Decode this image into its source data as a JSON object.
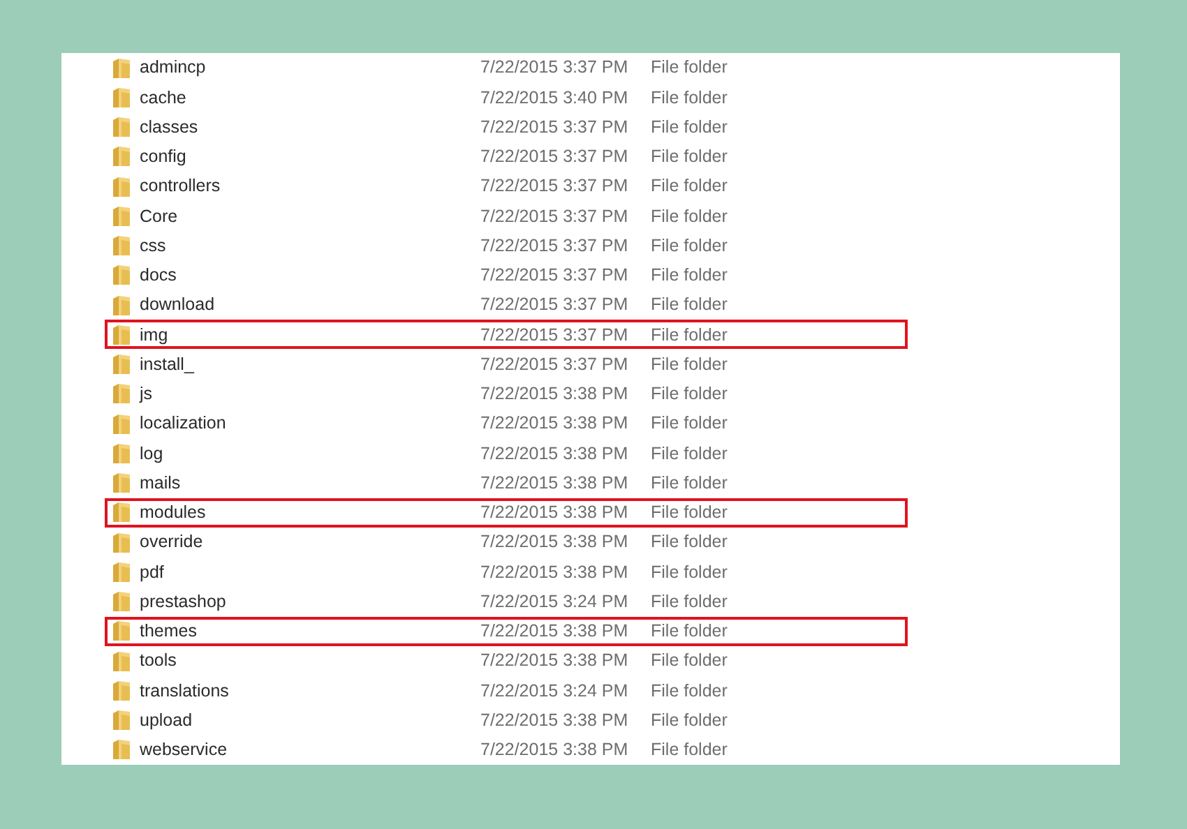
{
  "rows": [
    {
      "name": "admincp",
      "date": "7/22/2015 3:37 PM",
      "type": "File folder",
      "highlighted": false
    },
    {
      "name": "cache",
      "date": "7/22/2015 3:40 PM",
      "type": "File folder",
      "highlighted": false
    },
    {
      "name": "classes",
      "date": "7/22/2015 3:37 PM",
      "type": "File folder",
      "highlighted": false
    },
    {
      "name": "config",
      "date": "7/22/2015 3:37 PM",
      "type": "File folder",
      "highlighted": false
    },
    {
      "name": "controllers",
      "date": "7/22/2015 3:37 PM",
      "type": "File folder",
      "highlighted": false
    },
    {
      "name": "Core",
      "date": "7/22/2015 3:37 PM",
      "type": "File folder",
      "highlighted": false
    },
    {
      "name": "css",
      "date": "7/22/2015 3:37 PM",
      "type": "File folder",
      "highlighted": false
    },
    {
      "name": "docs",
      "date": "7/22/2015 3:37 PM",
      "type": "File folder",
      "highlighted": false
    },
    {
      "name": "download",
      "date": "7/22/2015 3:37 PM",
      "type": "File folder",
      "highlighted": false
    },
    {
      "name": "img",
      "date": "7/22/2015 3:37 PM",
      "type": "File folder",
      "highlighted": true
    },
    {
      "name": "install_",
      "date": "7/22/2015 3:37 PM",
      "type": "File folder",
      "highlighted": false
    },
    {
      "name": "js",
      "date": "7/22/2015 3:38 PM",
      "type": "File folder",
      "highlighted": false
    },
    {
      "name": "localization",
      "date": "7/22/2015 3:38 PM",
      "type": "File folder",
      "highlighted": false
    },
    {
      "name": "log",
      "date": "7/22/2015 3:38 PM",
      "type": "File folder",
      "highlighted": false
    },
    {
      "name": "mails",
      "date": "7/22/2015 3:38 PM",
      "type": "File folder",
      "highlighted": false
    },
    {
      "name": "modules",
      "date": "7/22/2015 3:38 PM",
      "type": "File folder",
      "highlighted": true
    },
    {
      "name": "override",
      "date": "7/22/2015 3:38 PM",
      "type": "File folder",
      "highlighted": false
    },
    {
      "name": "pdf",
      "date": "7/22/2015 3:38 PM",
      "type": "File folder",
      "highlighted": false
    },
    {
      "name": "prestashop",
      "date": "7/22/2015 3:24 PM",
      "type": "File folder",
      "highlighted": false
    },
    {
      "name": "themes",
      "date": "7/22/2015 3:38 PM",
      "type": "File folder",
      "highlighted": true
    },
    {
      "name": "tools",
      "date": "7/22/2015 3:38 PM",
      "type": "File folder",
      "highlighted": false
    },
    {
      "name": "translations",
      "date": "7/22/2015 3:24 PM",
      "type": "File folder",
      "highlighted": false
    },
    {
      "name": "upload",
      "date": "7/22/2015 3:38 PM",
      "type": "File folder",
      "highlighted": false
    },
    {
      "name": "webservice",
      "date": "7/22/2015 3:38 PM",
      "type": "File folder",
      "highlighted": false
    }
  ]
}
